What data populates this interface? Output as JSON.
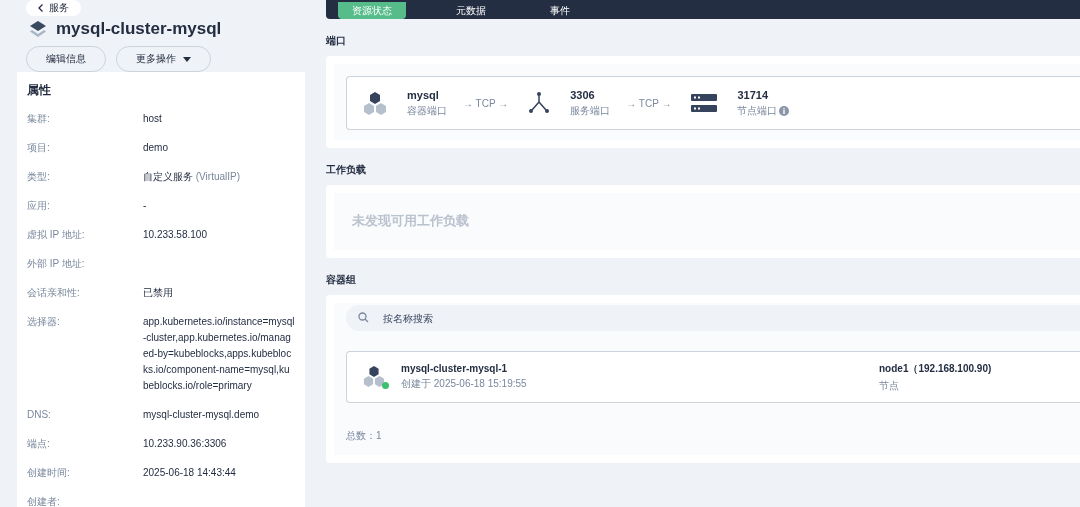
{
  "back_button": {
    "label": "服务"
  },
  "title": "mysql-cluster-mysql",
  "actions": [
    {
      "label": "编辑信息",
      "kind": "plain"
    },
    {
      "label": "更多操作",
      "kind": "dropdown"
    }
  ],
  "properties": {
    "heading": "属性",
    "rows": [
      {
        "label": "集群:",
        "value": "host"
      },
      {
        "label": "项目:",
        "value": "demo"
      },
      {
        "label": "类型:",
        "value": "自定义服务 *(VirtualIP)*"
      },
      {
        "label": "应用:",
        "value": "-"
      },
      {
        "label": "虚拟 IP 地址:",
        "value": "10.233.58.100"
      },
      {
        "label": "外部 IP 地址:"
      },
      {
        "label": "会话亲和性:",
        "value": "已禁用"
      },
      {
        "label": "选择器:",
        "value": "app.kubernetes.io/instance=mysql-cluster,app.kubernetes.io/managed-by=kubeblocks,apps.kubeblocks.io/component-name=mysql,kubeblocks.io/role=primary"
      },
      {
        "label": "DNS:",
        "value": "mysql-cluster-mysql.demo"
      },
      {
        "label": "端点:",
        "value": "10.233.90.36:3306"
      },
      {
        "label": "创建时间:",
        "value": "2025-06-18 14:43:44"
      },
      {
        "label": "创建者:"
      }
    ]
  },
  "tabs": [
    {
      "label": "资源状态",
      "selected": true
    },
    {
      "label": "元数据",
      "selected": false
    },
    {
      "label": "事件",
      "selected": false
    }
  ],
  "ports": {
    "heading": "端口",
    "container": {
      "value": "mysql",
      "label": "容器端口"
    },
    "protocol_1": "→ TCP →",
    "service": {
      "value": "3306",
      "label": "服务端口"
    },
    "protocol_2": "→ TCP →",
    "node": {
      "value": "31714",
      "label": "节点端口"
    }
  },
  "workloads": {
    "heading": "工作负载",
    "empty_text": "未发现可用工作负载"
  },
  "pods": {
    "heading": "容器组",
    "search": {
      "placeholder": "按名称搜索"
    },
    "items": [
      {
        "name": "mysql-cluster-mysql-1",
        "created": "创建于 2025-06-18 15:19:55",
        "node": "node1（192.168.100.90)",
        "node_label": "节点",
        "color": "#3fbf6f"
      }
    ],
    "total": "总数：1"
  }
}
